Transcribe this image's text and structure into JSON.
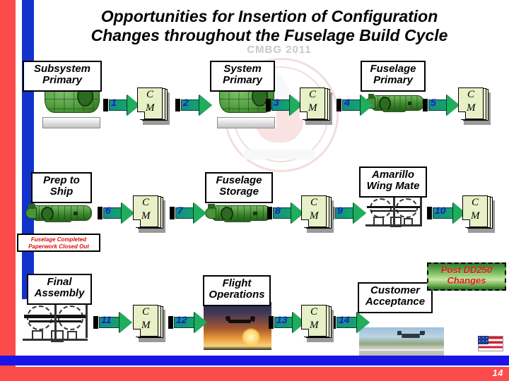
{
  "slide": {
    "title_line1": "Opportunities for Insertion of Configuration",
    "title_line2": "Changes throughout the Fuselage Build Cycle",
    "watermark_text": "CMBG 2011",
    "page_number": "14",
    "accent_red": "#fc4b4b",
    "accent_blue": "#1133cc",
    "arrow_green": "#1eae5c",
    "cm_paper": "#e7f0c6"
  },
  "stages": [
    {
      "label": "Subsystem\nPrimary",
      "label_l1": "Subsystem",
      "label_l2": "Primary",
      "graphic": "fuselage-cross-section"
    },
    {
      "label": "System\nPrimary",
      "label_l1": "System",
      "label_l2": "Primary",
      "graphic": "fuselage-cross-section"
    },
    {
      "label": "Fuselage\nPrimary",
      "label_l1": "Fuselage",
      "label_l2": "Primary",
      "graphic": "fuselage-side-view"
    },
    {
      "label": "Prep to\nShip",
      "label_l1": "Prep to",
      "label_l2": "Ship",
      "graphic": "fuselage-side-view"
    },
    {
      "label": "Fuselage\nStorage",
      "label_l1": "Fuselage",
      "label_l2": "Storage",
      "graphic": "fuselage-side-view"
    },
    {
      "label": "Amarillo\nWing Mate",
      "label_l1": "Amarillo",
      "label_l2": "Wing Mate",
      "graphic": "wing-mate-line-drawing"
    },
    {
      "label": "Final\nAssembly",
      "label_l1": "Final",
      "label_l2": "Assembly",
      "graphic": "wing-mate-line-drawing"
    },
    {
      "label": "Flight\nOperations",
      "label_l1": "Flight",
      "label_l2": "Operations",
      "graphic": "osprey-sunset-photo"
    },
    {
      "label": "Customer\nAcceptance",
      "label_l1": "Customer",
      "label_l2": "Acceptance",
      "graphic": "osprey-ramp-photo"
    }
  ],
  "arrows": [
    {
      "number": "1"
    },
    {
      "number": "2"
    },
    {
      "number": "3"
    },
    {
      "number": "4"
    },
    {
      "number": "5"
    },
    {
      "number": "6"
    },
    {
      "number": "7"
    },
    {
      "number": "8"
    },
    {
      "number": "9"
    },
    {
      "number": "10"
    },
    {
      "number": "11"
    },
    {
      "number": "12"
    },
    {
      "number": "13"
    },
    {
      "number": "14"
    }
  ],
  "cm_nodes": [
    {
      "line1": "C",
      "line2": "M"
    },
    {
      "line1": "C",
      "line2": "M"
    },
    {
      "line1": "C",
      "line2": "M"
    },
    {
      "line1": "C",
      "line2": "M"
    },
    {
      "line1": "C",
      "line2": "M"
    },
    {
      "line1": "C",
      "line2": "M"
    },
    {
      "line1": "C",
      "line2": "M"
    }
  ],
  "callouts": {
    "fuselage_completed_l1": "Fuselage Completed",
    "fuselage_completed_l2": "Paperwork Closed Out",
    "post_dd250_l1": "Post DD250",
    "post_dd250_l2": "Changes"
  },
  "flag": {
    "name": "united-states-flag"
  }
}
